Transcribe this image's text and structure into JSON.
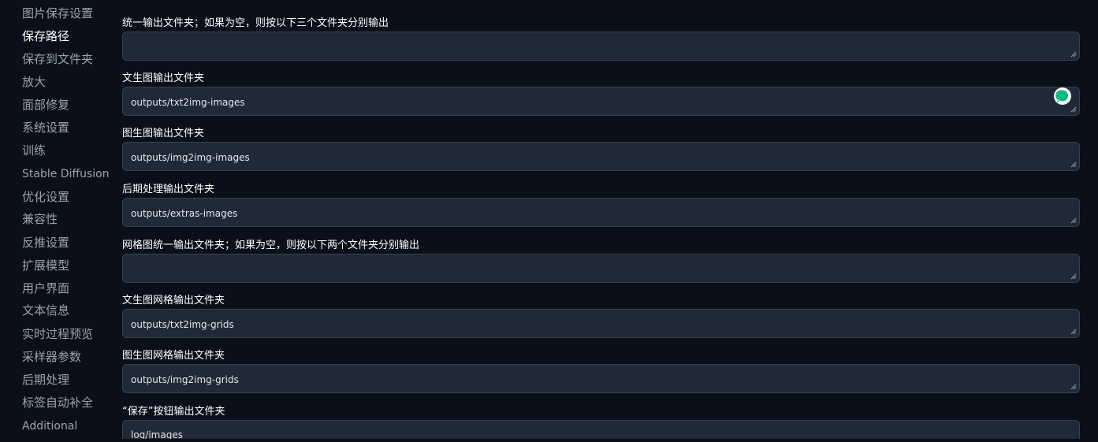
{
  "sidebar": {
    "items": [
      {
        "label": "图片保存设置",
        "active": false
      },
      {
        "label": "保存路径",
        "active": true
      },
      {
        "label": "保存到文件夹",
        "active": false
      },
      {
        "label": "放大",
        "active": false
      },
      {
        "label": "面部修复",
        "active": false
      },
      {
        "label": "系统设置",
        "active": false
      },
      {
        "label": "训练",
        "active": false
      },
      {
        "label": "Stable Diffusion",
        "active": false
      },
      {
        "label": "优化设置",
        "active": false
      },
      {
        "label": "兼容性",
        "active": false
      },
      {
        "label": "反推设置",
        "active": false
      },
      {
        "label": "扩展模型",
        "active": false
      },
      {
        "label": "用户界面",
        "active": false
      },
      {
        "label": "文本信息",
        "active": false
      },
      {
        "label": "实时过程预览",
        "active": false
      },
      {
        "label": "采样器参数",
        "active": false
      },
      {
        "label": "后期处理",
        "active": false
      },
      {
        "label": "标签自动补全",
        "active": false
      },
      {
        "label": "Additional",
        "active": false
      }
    ]
  },
  "fields": [
    {
      "label": "统一输出文件夹；如果为空，则按以下三个文件夹分别输出",
      "value": ""
    },
    {
      "label": "文生图输出文件夹",
      "value": "outputs/txt2img-images"
    },
    {
      "label": "图生图输出文件夹",
      "value": "outputs/img2img-images"
    },
    {
      "label": "后期处理输出文件夹",
      "value": "outputs/extras-images"
    },
    {
      "label": "网格图统一输出文件夹；如果为空，则按以下两个文件夹分别输出",
      "value": ""
    },
    {
      "label": "文生图网格输出文件夹",
      "value": "outputs/txt2img-grids"
    },
    {
      "label": "图生图网格输出文件夹",
      "value": "outputs/img2img-grids"
    },
    {
      "label": "“保存”按钮输出文件夹",
      "value": "log/images"
    }
  ],
  "icons": {
    "chat": "chat-bubble-icon",
    "grip": "resize-grip-icon"
  },
  "colors": {
    "background": "#0b0f19",
    "input_bg": "#1f2937",
    "input_border": "#374151",
    "text_muted": "#9ca3af",
    "text_active": "#ffffff",
    "chat_accent": "#10b981"
  }
}
